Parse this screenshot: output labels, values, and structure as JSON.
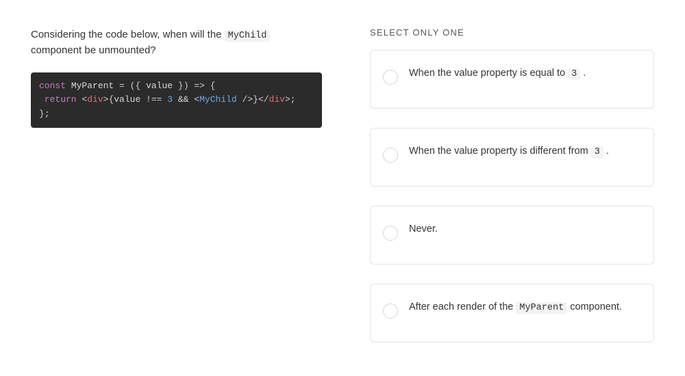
{
  "question": {
    "prefix": "Considering the code below, when will the ",
    "code_token": "MyChild",
    "suffix": " component be unmounted?"
  },
  "code": {
    "line1_kw": "const",
    "line1_name": " MyParent ",
    "line1_eq": "= ",
    "line1_paren_open": "(",
    "line1_brace_open": "{ ",
    "line1_param": "value",
    "line1_brace_close": " }",
    "line1_paren_close": ")",
    "line1_arrow": " => {",
    "line2_kw": " return",
    "line2_open_angle": " <",
    "line2_div1": "div",
    "line2_close_angle1": ">",
    "line2_expr_open": "{",
    "line2_expr_body": "value !== ",
    "line2_num": "3",
    "line2_and": " && ",
    "line2_open_angle2": "<",
    "line2_comp": "MyChild",
    "line2_selfclose": " />",
    "line2_expr_close": "}",
    "line2_open_angle3": "</",
    "line2_div2": "div",
    "line2_close_angle2": ">;",
    "line3": "};"
  },
  "select_label": "SELECT ONLY ONE",
  "options": [
    {
      "prefix": "When the value property is equal to ",
      "code": "3",
      "suffix": " ."
    },
    {
      "prefix": "When the value property is different from ",
      "code": "3",
      "suffix": " ."
    },
    {
      "prefix": "Never.",
      "code": "",
      "suffix": ""
    },
    {
      "prefix": "After each render of the ",
      "code": "MyParent",
      "suffix": " component."
    }
  ]
}
